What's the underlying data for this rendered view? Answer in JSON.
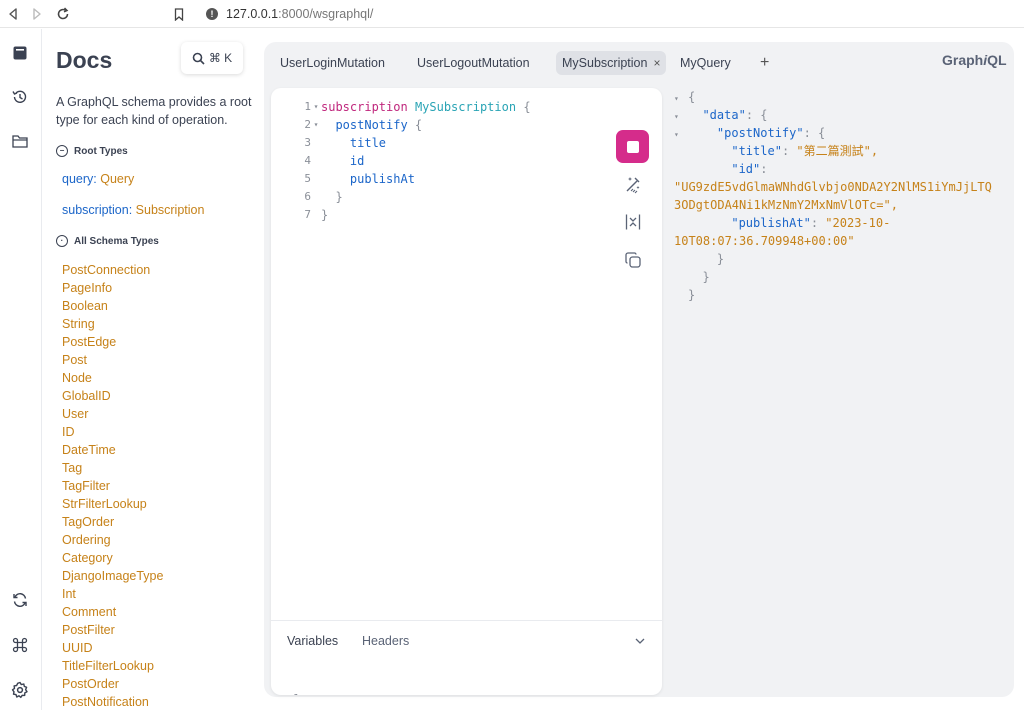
{
  "browser": {
    "url_host": "127.0.0.1",
    "url_path": ":8000/wsgraphql/"
  },
  "docs": {
    "title": "Docs",
    "search_shortcut": "⌘ K",
    "description": "A GraphQL schema provides a root type for each kind of operation.",
    "root_types_label": "Root Types",
    "root_types": [
      {
        "field": "query",
        "type": "Query"
      },
      {
        "field": "subscription",
        "type": "Subscription"
      }
    ],
    "all_types_label": "All Schema Types",
    "types": [
      "PostConnection",
      "PageInfo",
      "Boolean",
      "String",
      "PostEdge",
      "Post",
      "Node",
      "GlobalID",
      "User",
      "ID",
      "DateTime",
      "Tag",
      "TagFilter",
      "StrFilterLookup",
      "TagOrder",
      "Ordering",
      "Category",
      "DjangoImageType",
      "Int",
      "Comment",
      "PostFilter",
      "UUID",
      "TitleFilterLookup",
      "PostOrder",
      "PostNotification"
    ]
  },
  "tabs": [
    {
      "label": "UserLoginMutation",
      "active": false
    },
    {
      "label": "UserLogoutMutation",
      "active": false
    },
    {
      "label": "MySubscription",
      "active": true
    },
    {
      "label": "MyQuery",
      "active": false
    }
  ],
  "tab_close": "×",
  "tab_add": "+",
  "brand": {
    "prefix": "Graph",
    "italic": "i",
    "suffix": "QL"
  },
  "editor": {
    "keyword": "subscription",
    "operation_name": "MySubscription",
    "root_field": "postNotify",
    "fields": [
      "title",
      "id",
      "publishAt"
    ]
  },
  "variables_panel": {
    "variables_label": "Variables",
    "headers_label": "Headers",
    "line_number": "1"
  },
  "result": {
    "data_key": "\"data\"",
    "post_key": "\"postNotify\"",
    "title_key": "\"title\"",
    "title_value": "\"第二篇測試\",",
    "id_key": "\"id\"",
    "id_value_line1": "\"UG9zdE5vdGlmaWNhdGlvbjo0NDA2Y2NlMS1iYmJjLTQ",
    "id_value_line2": "3ODgtODA4Ni1kMzNmY2MxNmVlOTc=\",",
    "publish_key": "\"publishAt\"",
    "publish_value_line1": "\"2023-10-",
    "publish_value_line2": "10T08:07:36.709948+00:00\""
  }
}
